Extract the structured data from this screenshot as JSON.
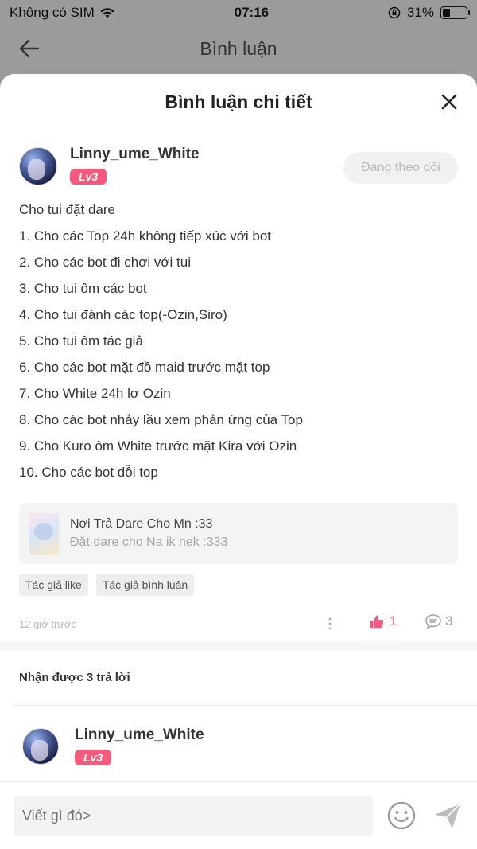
{
  "status_bar": {
    "carrier": "Không có SIM",
    "time": "07:16",
    "battery": "31%",
    "battery_level": 0.31
  },
  "navbar": {
    "title": "Bình luận"
  },
  "sheet": {
    "title": "Bình luận chi tiết"
  },
  "comment": {
    "username": "Linny_ume_White",
    "level": "Lv3",
    "follow_label": "Đang theo dõi",
    "lines": [
      "Cho tui đặt dare",
      "1. Cho các Top 24h không tiếp xúc với bot",
      "2. Cho các bot đi chơi với tui",
      "3. Cho tui ôm các bot",
      "4. Cho tui đánh các top(-Ozin,Siro)",
      "5. Cho tui ôm tác giả",
      "6. Cho các bot mặt đồ maid trước mặt top",
      "7. Cho White 24h lơ Ozin",
      "8. Cho các bot nhảy lầu xem phản ứng của Top",
      "9. Cho Kuro ôm White trước mặt Kira với Ozin",
      "10. Cho các bot dỗi top"
    ],
    "linked_post": {
      "title": "Nơi Trả Dare Cho Mn :33",
      "subtitle": "Đặt dare cho Na ik nek :333"
    },
    "tags": [
      "Tác giả like",
      "Tác giả bình luận"
    ],
    "time": "12 giờ trước",
    "likes": "1",
    "replies": "3",
    "accent_color": "#f35a7c"
  },
  "replies_section": {
    "header": "Nhận được 3 trả lời",
    "items": [
      {
        "username": "Linny_ume_White",
        "level": "Lv3"
      }
    ]
  },
  "composer": {
    "placeholder": "Viết gì đó>"
  },
  "icons": {
    "back": "arrow-left-icon",
    "close": "close-icon",
    "more": "more-vertical-icon",
    "like": "thumbs-up-icon",
    "reply": "chat-bubble-icon",
    "emoji": "smiley-icon",
    "send": "send-icon"
  }
}
